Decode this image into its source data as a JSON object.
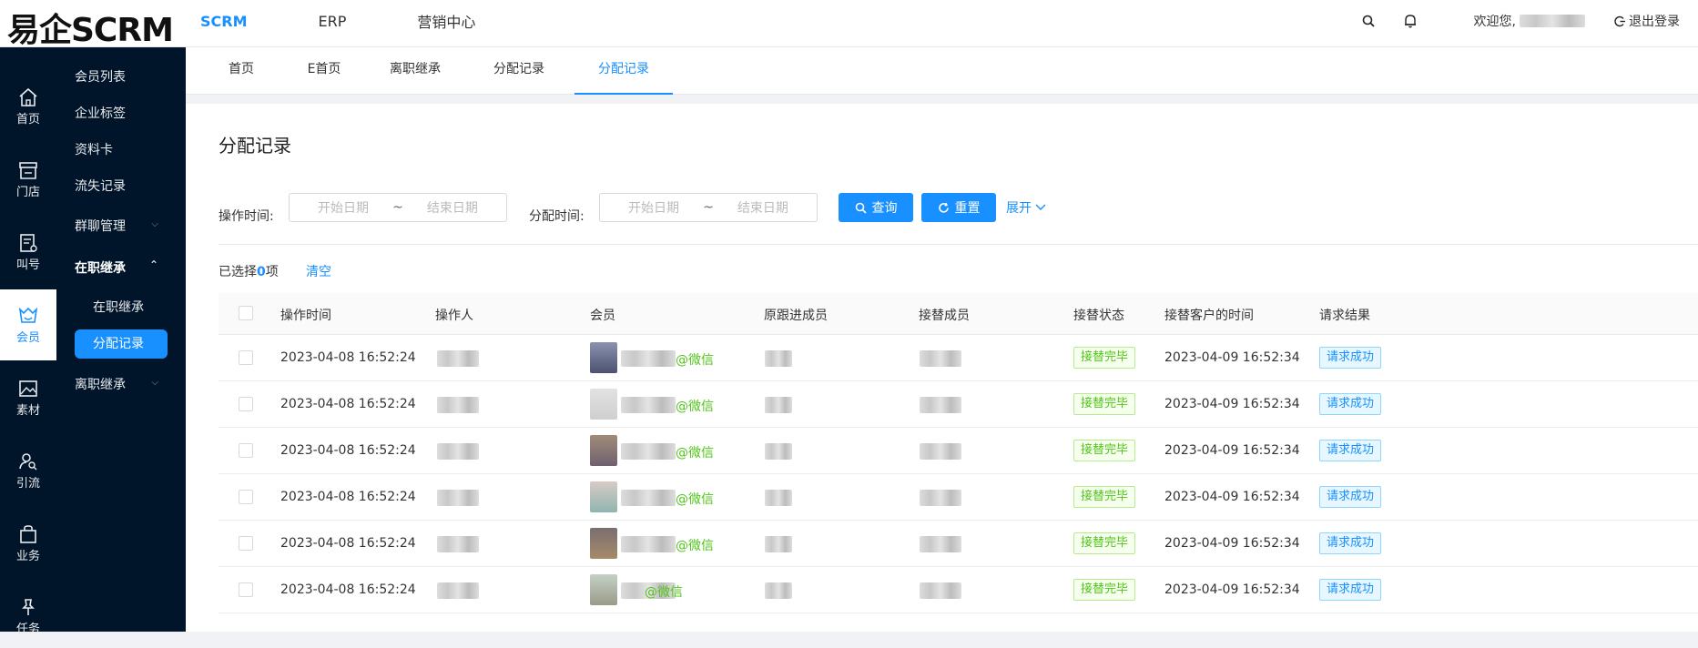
{
  "app": {
    "logo": "易企SCRM"
  },
  "topnav": {
    "items": [
      {
        "label": "SCRM",
        "active": true
      },
      {
        "label": "ERP",
        "active": false
      },
      {
        "label": "营销中心",
        "active": false
      }
    ]
  },
  "topright": {
    "welcome": "欢迎您,",
    "logout": "退出登录"
  },
  "leftbar": {
    "items": [
      {
        "label": "首页",
        "icon": "home-icon"
      },
      {
        "label": "门店",
        "icon": "store-icon"
      },
      {
        "label": "叫号",
        "icon": "queue-icon"
      },
      {
        "label": "会员",
        "icon": "member-icon",
        "active": true
      },
      {
        "label": "素材",
        "icon": "image-icon"
      },
      {
        "label": "引流",
        "icon": "user-search-icon"
      },
      {
        "label": "业务",
        "icon": "bag-icon"
      },
      {
        "label": "任务",
        "icon": "pin-icon"
      }
    ]
  },
  "submenu": {
    "items": [
      "会员列表",
      "企业标签",
      "资料卡",
      "流失记录"
    ],
    "group_chat": "群聊管理",
    "inherit_on": "在职继承",
    "inherit_on_children": [
      "在职继承",
      "分配记录"
    ],
    "inherit_off": "离职继承"
  },
  "tabs": [
    "首页",
    "E首页",
    "离职继承",
    "分配记录",
    "分配记录"
  ],
  "page": {
    "title": "分配记录",
    "filters": {
      "op_time_label": "操作时间:",
      "assign_time_label": "分配时间:",
      "start_placeholder": "开始日期",
      "end_placeholder": "结束日期",
      "tilde": "~"
    },
    "query_label": "查询",
    "reset_label": "重置",
    "expand_label": "展开",
    "selected_prefix": "已选择",
    "selected_count": "0",
    "selected_suffix": "项",
    "clear_label": "清空"
  },
  "table": {
    "headers": [
      "操作时间",
      "操作人",
      "会员",
      "原跟进成员",
      "接替成员",
      "接替状态",
      "接替客户的时间",
      "请求结果"
    ],
    "rows": [
      {
        "op_time": "2023-04-08 16:52:24",
        "member_suffix": "@微信",
        "status": "接替完毕",
        "takeover_time": "2023-04-09 16:52:34",
        "result": "请求成功"
      },
      {
        "op_time": "2023-04-08 16:52:24",
        "member_suffix": "@微信",
        "status": "接替完毕",
        "takeover_time": "2023-04-09 16:52:34",
        "result": "请求成功"
      },
      {
        "op_time": "2023-04-08 16:52:24",
        "member_suffix": "@微信",
        "status": "接替完毕",
        "takeover_time": "2023-04-09 16:52:34",
        "result": "请求成功"
      },
      {
        "op_time": "2023-04-08 16:52:24",
        "member_suffix": "@微信",
        "status": "接替完毕",
        "takeover_time": "2023-04-09 16:52:34",
        "result": "请求成功"
      },
      {
        "op_time": "2023-04-08 16:52:24",
        "member_suffix": "@微信",
        "status": "接替完毕",
        "takeover_time": "2023-04-09 16:52:34",
        "result": "请求成功"
      },
      {
        "op_time": "2023-04-08 16:52:24",
        "member_suffix": "@微信",
        "status": "接替完毕",
        "takeover_time": "2023-04-09 16:52:34",
        "result": "请求成功"
      }
    ]
  },
  "colors": {
    "accent": "#1890ff",
    "sidebar": "#001529",
    "success": "#52c41a"
  }
}
